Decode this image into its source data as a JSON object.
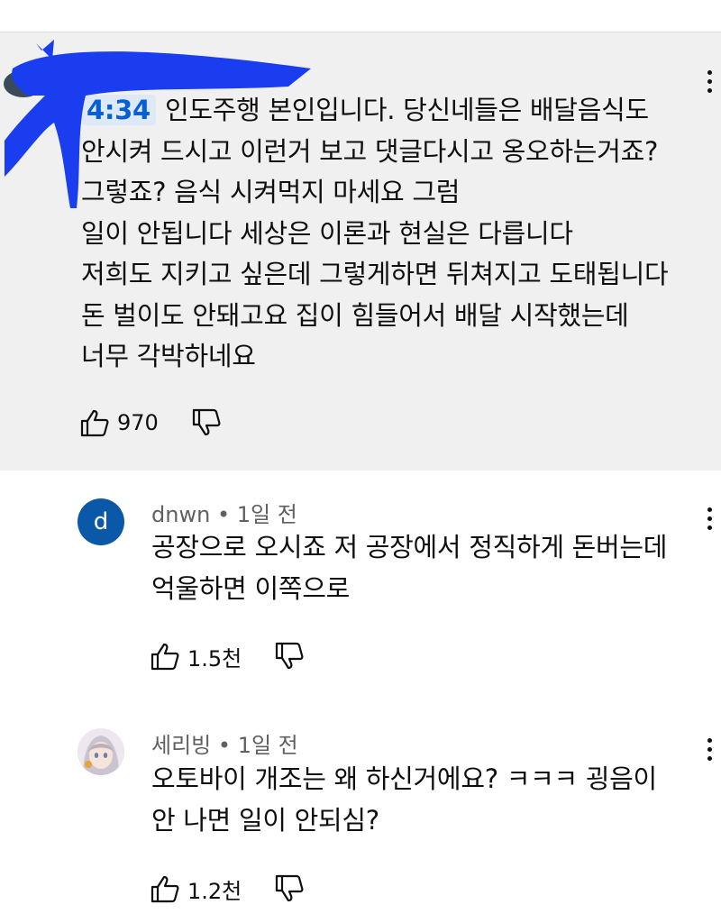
{
  "highlighted_comment": {
    "timestamp": "4:34",
    "lines": [
      "인도주행 본인입니다. 당신네들은 배달음식도",
      "안시켜 드시고 이런거 보고 댓글다시고 옹오하는거죠?",
      "그렇죠? 음식 시켜먹지 마세요 그럼",
      "일이 안됩니다 세상은 이론과 현실은 다릅니다",
      "저희도 지키고 싶은데 그렇게하면 뒤쳐지고 도태됩니다",
      "돈 벌이도 안돼고요 집이 힘들어서 배달 시작했는데",
      "너무 각박하네요"
    ],
    "likes": "970"
  },
  "replies": [
    {
      "avatar_letter": "d",
      "author": "dnwn",
      "separator": "•",
      "time": "1일 전",
      "lines": [
        "공장으로 오시죠 저 공장에서 정직하게 돈버는데",
        "억울하면 이쪽으로"
      ],
      "likes": "1.5천"
    },
    {
      "avatar_letter": "",
      "author": "세리빙",
      "separator": "•",
      "time": "1일 전",
      "lines": [
        "오토바이 개조는 왜 하신거에요? ㅋㅋㅋ 굉음이",
        "안 나면 일이 안되심?"
      ],
      "likes": "1.2천"
    }
  ],
  "icons": {
    "like": "thumbs-up-icon",
    "dislike": "thumbs-down-icon",
    "more": "more-vert-icon"
  },
  "colors": {
    "highlight_bg": "#f0f0f0",
    "timestamp": "#065fd4",
    "scribble": "#1a3df0",
    "avatar_d": "#0b57a8"
  }
}
